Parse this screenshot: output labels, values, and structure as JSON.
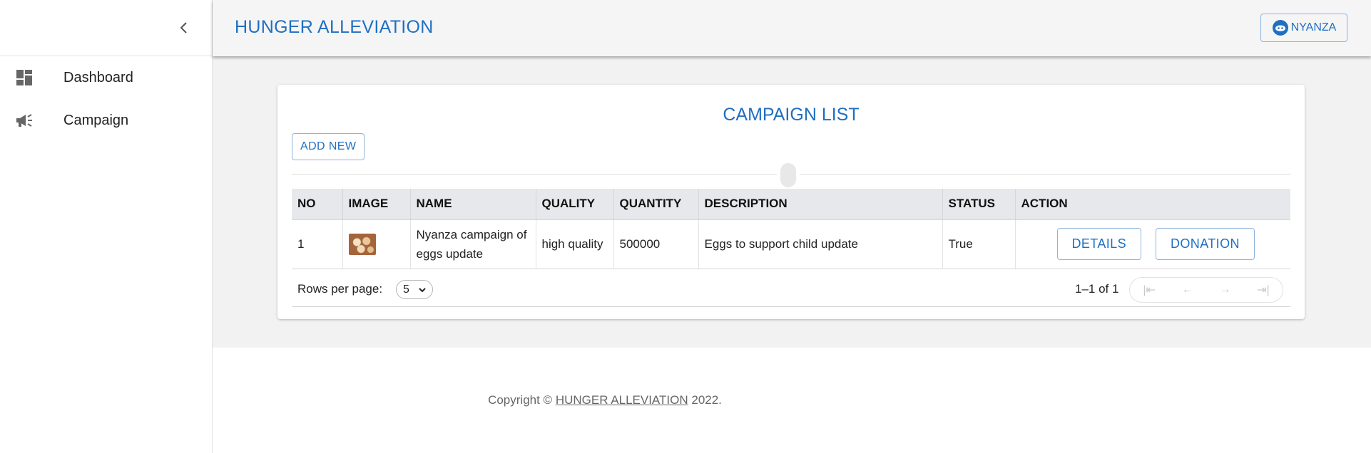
{
  "header": {
    "title": "HUNGER ALLEVIATION",
    "user_label": "NYANZA"
  },
  "sidebar": {
    "items": [
      {
        "label": "Dashboard",
        "icon": "dashboard-icon"
      },
      {
        "label": "Campaign",
        "icon": "campaign-icon"
      }
    ]
  },
  "card": {
    "title": "CAMPAIGN LIST",
    "add_button": "ADD NEW"
  },
  "table": {
    "columns": [
      "NO",
      "IMAGE",
      "NAME",
      "QUALITY",
      "QUANTITY",
      "DESCRIPTION",
      "STATUS",
      "ACTION"
    ],
    "rows": [
      {
        "no": "1",
        "name": "Nyanza campaign of eggs update",
        "quality": "high quality",
        "quantity": "500000",
        "description": "Eggs to support child update",
        "status": "True",
        "details_label": "DETAILS",
        "donation_label": "DONATION"
      }
    ]
  },
  "pagination": {
    "rows_per_page_label": "Rows per page:",
    "rows_per_page_value": "5",
    "range": "1–1 of 1"
  },
  "footer": {
    "prefix": "Copyright ©",
    "link": "HUNGER ALLEVIATION",
    "suffix": "2022."
  },
  "colors": {
    "accent": "#1f6fc1",
    "header_bg": "#f5f5f5",
    "main_bg": "#f2f2f2"
  }
}
